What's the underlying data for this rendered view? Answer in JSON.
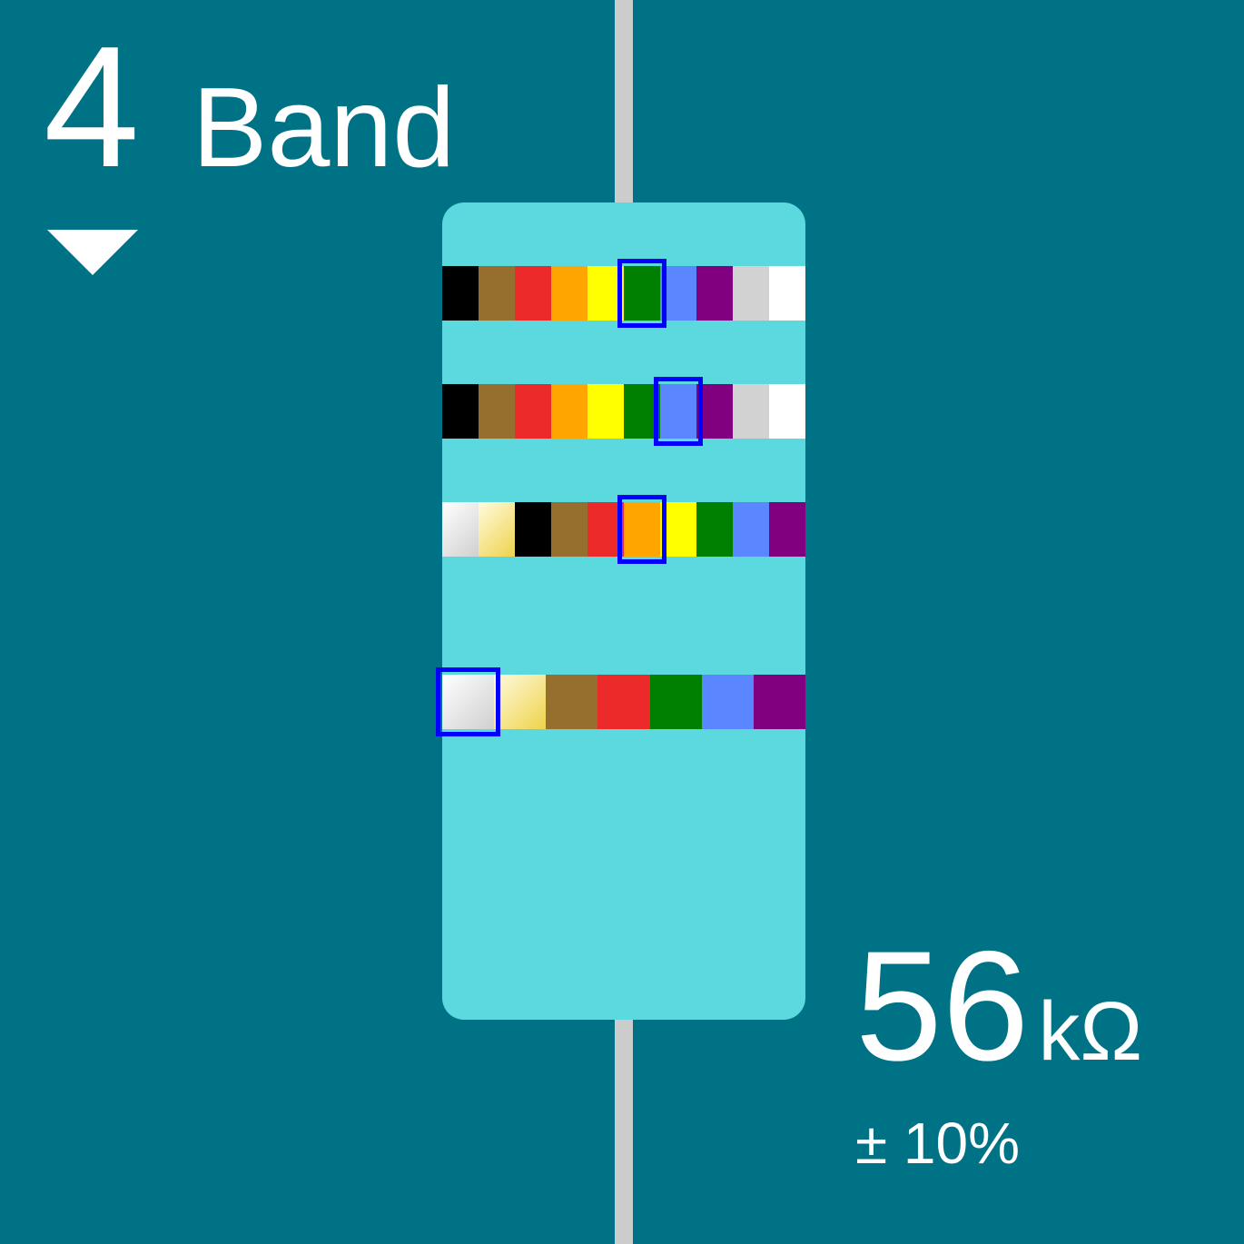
{
  "header": {
    "band_count": "4",
    "band_label": "Band",
    "toggle_icon": "triangle-down-icon"
  },
  "readout": {
    "value": "56",
    "unit": "kΩ",
    "tolerance": "± 10%"
  },
  "colors": {
    "background": "#007286",
    "resistor_body": "#5cd9de",
    "lead_wire": "#cccccc",
    "selection": "#0000ff",
    "black": "#000000",
    "brown": "#966f2e",
    "red": "#ec2a2a",
    "orange": "#ffa500",
    "yellow": "#ffff00",
    "green": "#008000",
    "blue": "#5a87ff",
    "violet": "#800080",
    "grey": "#d2d2d2",
    "white": "#ffffff",
    "silver": "linear-gradient(135deg, #ffffff, #d0d0d0)",
    "gold": "linear-gradient(135deg, #fffbe0, #eed34a)"
  },
  "bands": [
    {
      "name": "first-digit",
      "swatches": [
        "black",
        "brown",
        "red",
        "orange",
        "yellow",
        "green",
        "blue",
        "violet",
        "grey",
        "white"
      ],
      "selected": "green"
    },
    {
      "name": "second-digit",
      "swatches": [
        "black",
        "brown",
        "red",
        "orange",
        "yellow",
        "green",
        "blue",
        "violet",
        "grey",
        "white"
      ],
      "selected": "blue"
    },
    {
      "name": "multiplier",
      "swatches": [
        "silver",
        "gold",
        "black",
        "brown",
        "red",
        "orange",
        "yellow",
        "green",
        "blue",
        "violet"
      ],
      "selected": "orange"
    },
    {
      "name": "tolerance",
      "swatches": [
        "silver",
        "gold",
        "brown",
        "red",
        "green",
        "blue",
        "violet"
      ],
      "selected": "silver"
    }
  ]
}
